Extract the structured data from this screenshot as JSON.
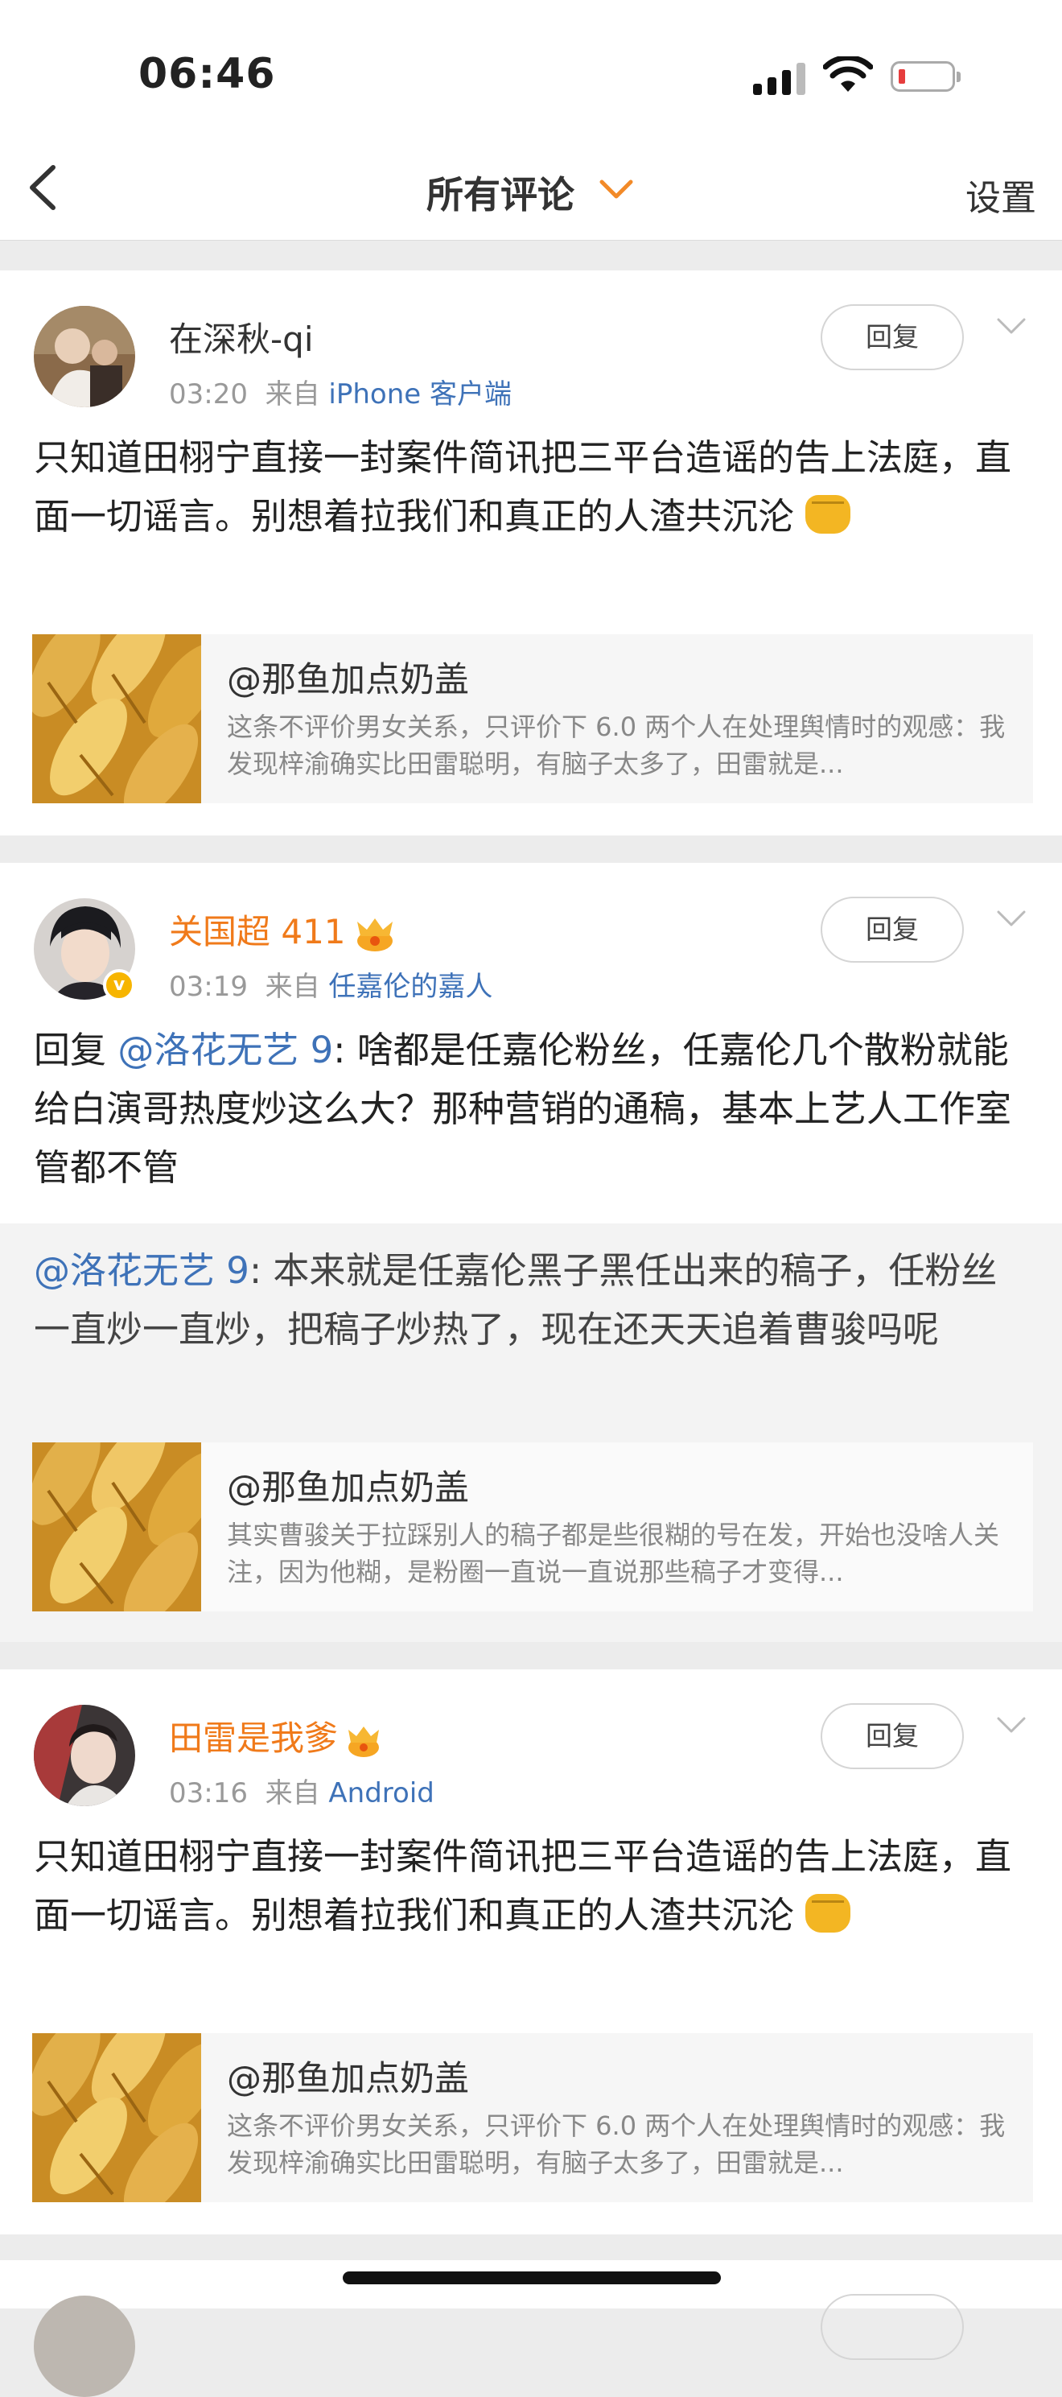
{
  "status": {
    "time": "06:46"
  },
  "nav": {
    "title": "所有评论",
    "settings_label": "设置"
  },
  "reply_button_label": "回复",
  "comments": [
    {
      "username": "在深秋-qi",
      "time": "03:20",
      "source_prefix": "来自",
      "source": "iPhone 客户端",
      "text": "只知道田栩宁直接一封案件简讯把三平台造谣的告上法庭，直面一切谣言。别想着拉我们和真正的人渣共沉沦",
      "emoji": "fist-icon",
      "link_card": {
        "title": "@那鱼加点奶盖",
        "desc": "这条不评价男女关系，只评价下 6.0 两个人在处理舆情时的观感：我发现梓渝确实比田雷聪明，有脑子太多了，田雷就是..."
      }
    },
    {
      "username": "关国超 411",
      "time": "03:19",
      "source_prefix": "来自",
      "source": "任嘉伦的嘉人",
      "reply_prefix": "回复",
      "reply_to": "@洛花无艺 9",
      "text": ": 啥都是任嘉伦粉丝，任嘉伦几个散粉就能给白演哥热度炒这么大？那种营销的通稿，基本上艺人工作室管都不管",
      "quoted": {
        "mention": "@洛花无艺 9",
        "text": ": 本来就是任嘉伦黑子黑任出来的稿子，任粉丝一直炒一直炒，把稿子炒热了，现在还天天追着曹骏吗呢"
      },
      "link_card": {
        "title": "@那鱼加点奶盖",
        "desc": "其实曹骏关于拉踩别人的稿子都是些很糊的号在发，开始也没啥人关注，因为他糊，是粉圈一直说一直说那些稿子才变得..."
      }
    },
    {
      "username": "田雷是我爹",
      "time": "03:16",
      "source_prefix": "来自",
      "source": "Android",
      "text": "只知道田栩宁直接一封案件简讯把三平台造谣的告上法庭，直面一切谣言。别想着拉我们和真正的人渣共沉沦",
      "emoji": "fist-icon",
      "link_card": {
        "title": "@那鱼加点奶盖",
        "desc": "这条不评价男女关系，只评价下 6.0 两个人在处理舆情时的观感：我发现梓渝确实比田雷聪明，有脑子太多了，田雷就是..."
      }
    }
  ]
}
